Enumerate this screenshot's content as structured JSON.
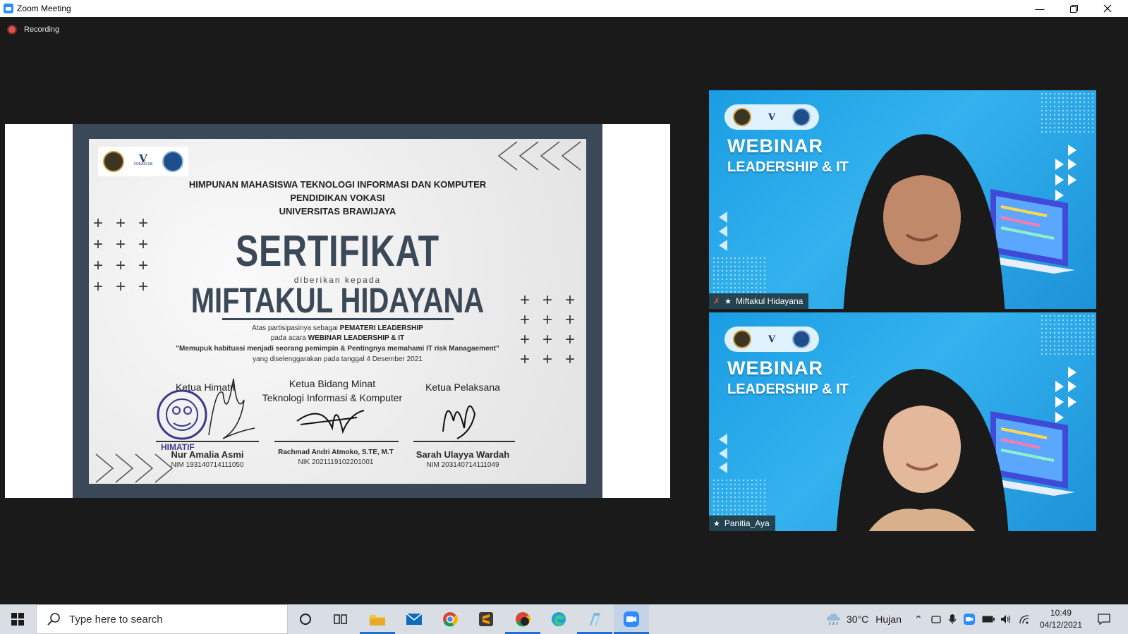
{
  "window": {
    "title": "Zoom Meeting"
  },
  "recording": {
    "label": "Recording"
  },
  "certificate": {
    "org_lines": [
      "HIMPUNAN MAHASISWA TEKNOLOGI INFORMASI DAN KOMPUTER",
      "PENDIDIKAN VOKASI",
      "UNIVERSITAS BRAWIJAYA"
    ],
    "logo_text": "VOKASI UB",
    "title": "SERTIFIKAT",
    "given_to": "diberikan kepada",
    "recipient": "MIFTAKUL HIDAYANA",
    "line1_prefix": "Atas partisipasinya sebagai ",
    "line1_bold": "PEMATERI LEADERSHIP",
    "line2_prefix": "pada acara ",
    "line2_bold": "WEBINAR LEADERSHIP & IT",
    "line3": "\"Memupuk habituasi menjadi seorang pemimpin & Pentingnya memahami IT risk Managaement\"",
    "line4": "yang diselenggarakan pada tanggal 4 Desember 2021",
    "stamp_text": "HIMATIF",
    "signatories": [
      {
        "role": "Ketua Himatif",
        "name": "Nur Amalia Asmi",
        "id": "NIM 193140714111050"
      },
      {
        "role_line1": "Ketua Bidang Minat",
        "role_line2": "Teknologi Informasi & Komputer",
        "name": "Rachmad Andri Atmoko, S.TE, M.T",
        "id": "NIK 2021119102201001"
      },
      {
        "role": "Ketua Pelaksana",
        "name": "Sarah Ulayya Wardah",
        "id": "NIM 203140714111049"
      }
    ]
  },
  "participants": [
    {
      "name": "Miftakul Hidayana",
      "muted": true,
      "banner_line1": "WEBINAR",
      "banner_line2": "LEADERSHIP & IT"
    },
    {
      "name": "Panitia_Aya",
      "muted": false,
      "banner_line1": "WEBINAR",
      "banner_line2": "LEADERSHIP & IT"
    }
  ],
  "taskbar": {
    "search_placeholder": "Type here to search",
    "weather_temp": "30°C",
    "weather_desc": "Hujan",
    "time": "10:49",
    "date": "04/12/2021",
    "apps": [
      "cortana-icon",
      "task-view-icon",
      "file-explorer-icon",
      "mail-icon",
      "chrome-icon",
      "sublime-text-icon",
      "chrome-alt-icon",
      "edge-icon",
      "app-icon",
      "zoom-icon"
    ]
  },
  "colors": {
    "cert_dark": "#3a4858",
    "tile_blue": "#1b9de3",
    "recording_red": "#e0524a",
    "taskbar": "#d9dde4"
  }
}
